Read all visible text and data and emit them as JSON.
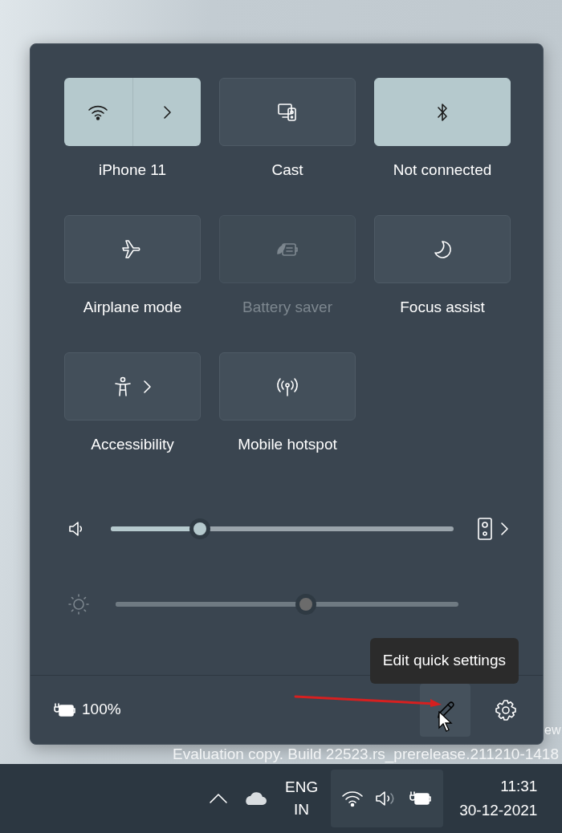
{
  "quick_settings": {
    "tiles": [
      {
        "kind": "split",
        "label": "iPhone 11",
        "on": true,
        "disabled": false
      },
      {
        "kind": "toggle",
        "label": "Cast",
        "on": false,
        "disabled": false
      },
      {
        "kind": "toggle",
        "label": "Not connected",
        "on": true,
        "disabled": false
      },
      {
        "kind": "toggle",
        "label": "Airplane mode",
        "on": false,
        "disabled": false
      },
      {
        "kind": "toggle",
        "label": "Battery saver",
        "on": false,
        "disabled": true
      },
      {
        "kind": "toggle",
        "label": "Focus assist",
        "on": false,
        "disabled": false
      },
      {
        "kind": "menu",
        "label": "Accessibility",
        "on": false,
        "disabled": false
      },
      {
        "kind": "toggle",
        "label": "Mobile hotspot",
        "on": false,
        "disabled": false
      }
    ],
    "sliders": [
      {
        "kind": "volume",
        "level": 0.26,
        "disabled": false
      },
      {
        "kind": "brightness",
        "level": 0.555,
        "disabled": true
      }
    ],
    "footer": {
      "battery": "100%",
      "tooltip": "Edit quick settings"
    }
  },
  "desktop": {
    "watermark": [
      "ew",
      "Evaluation copy. Build 22523.rs_prerelease.211210-1418"
    ]
  },
  "taskbar": {
    "language": "ENG",
    "region": "IN",
    "time": "11:31",
    "date": "30-12-2021"
  }
}
